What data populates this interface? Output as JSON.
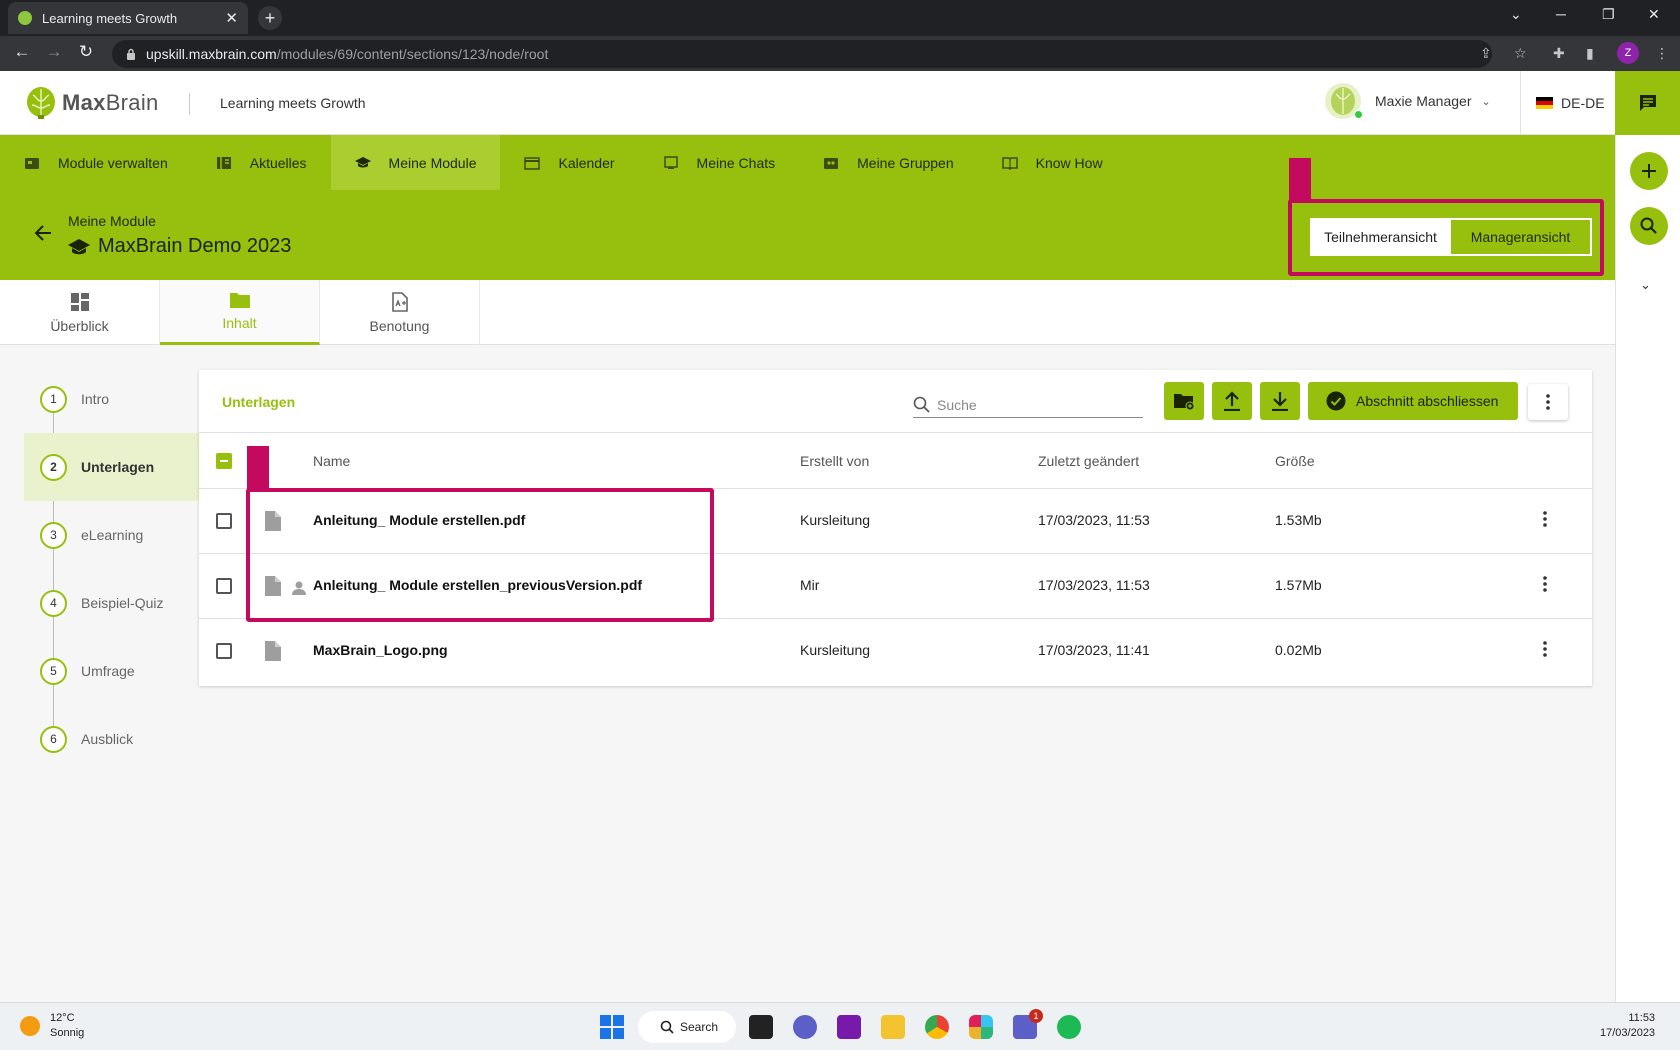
{
  "browser": {
    "tab_title": "Learning meets Growth",
    "tab_close": "✕",
    "new_tab": "+",
    "url_host": "upskill.maxbrain.com",
    "url_path": "/modules/69/content/sections/123/node/root",
    "profile_initial": "Z"
  },
  "header": {
    "logo_bold": "Max",
    "logo_light": "Brain",
    "tagline": "Learning meets Growth",
    "user_name": "Maxie Manager",
    "language": "DE-DE"
  },
  "nav": {
    "items": [
      {
        "label": "Module verwalten",
        "icon": "module-manage-icon"
      },
      {
        "label": "Aktuelles",
        "icon": "news-icon"
      },
      {
        "label": "Meine Module",
        "icon": "graduation-cap-icon"
      },
      {
        "label": "Kalender",
        "icon": "calendar-icon"
      },
      {
        "label": "Meine Chats",
        "icon": "chat-icon"
      },
      {
        "label": "Meine Gruppen",
        "icon": "groups-icon"
      },
      {
        "label": "Know How",
        "icon": "book-icon"
      }
    ]
  },
  "page": {
    "breadcrumb": "Meine Module",
    "title": "MaxBrain Demo 2023",
    "view_participant": "Teilnehmeransicht",
    "view_manager": "Manageransicht"
  },
  "subtabs": {
    "overview": "Überblick",
    "content": "Inhalt",
    "grading": "Benotung"
  },
  "steps": [
    {
      "num": "1",
      "label": "Intro"
    },
    {
      "num": "2",
      "label": "Unterlagen"
    },
    {
      "num": "3",
      "label": "eLearning"
    },
    {
      "num": "4",
      "label": "Beispiel-Quiz"
    },
    {
      "num": "5",
      "label": "Umfrage"
    },
    {
      "num": "6",
      "label": "Ausblick"
    }
  ],
  "files": {
    "section_title": "Unterlagen",
    "search_placeholder": "Suche",
    "complete_button": "Abschnitt abschliessen",
    "columns": {
      "name": "Name",
      "created_by": "Erstellt von",
      "modified": "Zuletzt geändert",
      "size": "Größe"
    },
    "rows": [
      {
        "name": "Anleitung_ Module erstellen.pdf",
        "created_by": "Kursleitung",
        "modified": "17/03/2023, 11:53",
        "size": "1.53Mb"
      },
      {
        "name": "Anleitung_ Module erstellen_previousVersion.pdf",
        "created_by": "Mir",
        "modified": "17/03/2023, 11:53",
        "size": "1.57Mb"
      },
      {
        "name": "MaxBrain_Logo.png",
        "created_by": "Kursleitung",
        "modified": "17/03/2023, 11:41",
        "size": "0.02Mb"
      }
    ]
  },
  "taskbar": {
    "temperature": "12°C",
    "weather": "Sonnig",
    "search": "Search",
    "time": "11:53",
    "date": "17/03/2023",
    "teams_badge": "1"
  },
  "colors": {
    "brand_green": "#97c00e",
    "highlight": "#c40a5f"
  }
}
